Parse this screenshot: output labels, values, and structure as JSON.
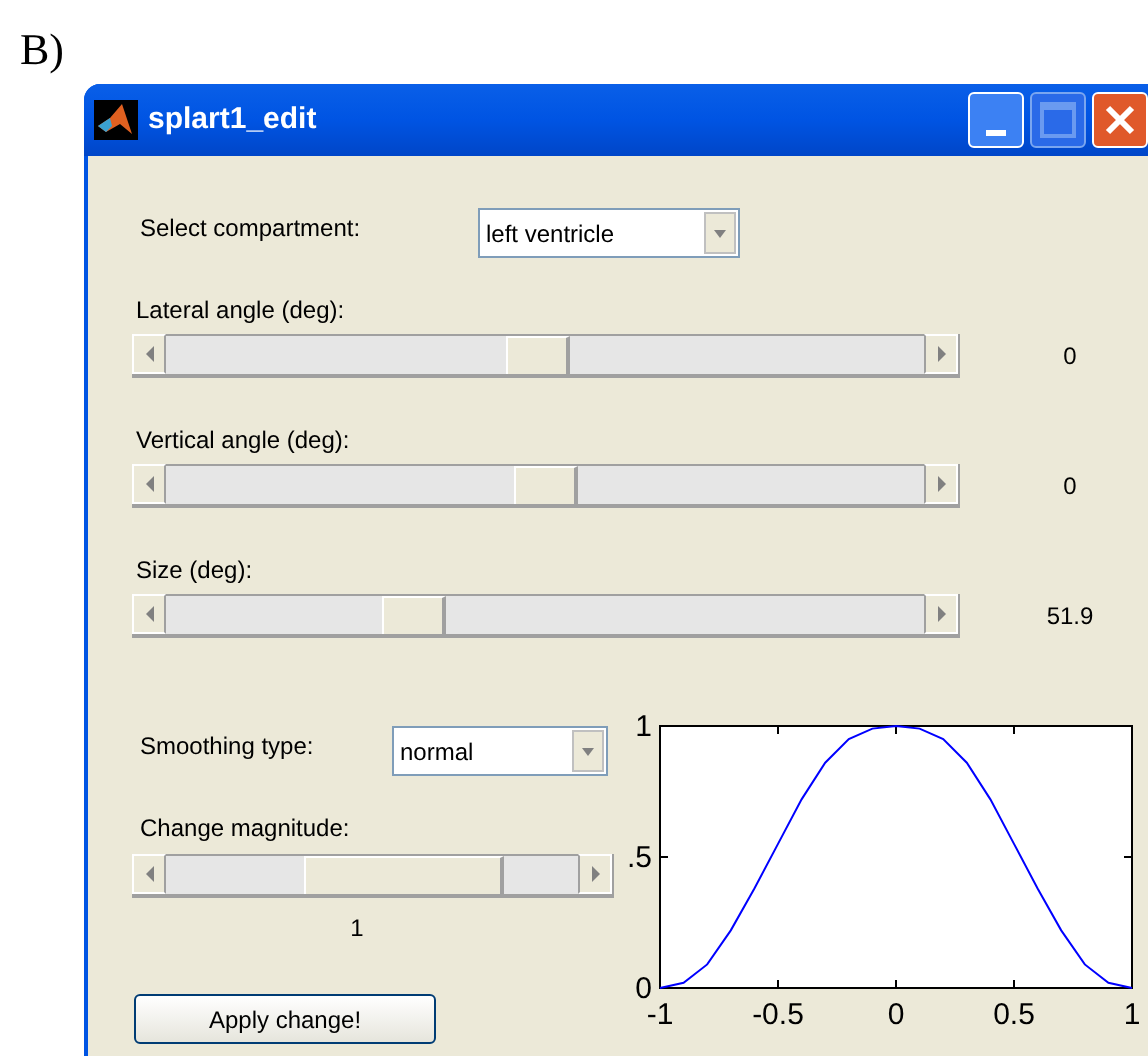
{
  "figure_label": "B)",
  "window": {
    "title": "splart1_edit"
  },
  "compartment": {
    "label": "Select compartment:",
    "value": "left ventricle"
  },
  "sliders": [
    {
      "label": "Lateral angle (deg):",
      "level": 0.49,
      "reading": "0"
    },
    {
      "label": "Vertical angle (deg):",
      "level": 0.5,
      "reading": "0"
    },
    {
      "label": "Size (deg):",
      "level": 0.31,
      "reading": "51.9"
    }
  ],
  "smoothing": {
    "label": "Smoothing type:",
    "value": "normal"
  },
  "magnitude": {
    "label": "Change magnitude:",
    "level": 0.65,
    "reading": "1"
  },
  "apply_button": "Apply change!",
  "chart_data": {
    "type": "line",
    "xlim": [
      -1,
      1
    ],
    "ylim": [
      0,
      1
    ],
    "xticks": [
      -1,
      -0.5,
      0,
      0.5,
      1
    ],
    "yticks": [
      0,
      {
        "value": 0.5,
        "label": ".5"
      },
      1
    ],
    "x": [
      -1,
      -0.9,
      -0.8,
      -0.7,
      -0.6,
      -0.5,
      -0.4,
      -0.3,
      -0.2,
      -0.1,
      0,
      0.1,
      0.2,
      0.3,
      0.4,
      0.5,
      0.6,
      0.7,
      0.8,
      0.9,
      1
    ],
    "series": [
      {
        "color": "#0000ff",
        "values": [
          0,
          0.02,
          0.09,
          0.22,
          0.38,
          0.55,
          0.72,
          0.86,
          0.95,
          0.99,
          1,
          0.99,
          0.95,
          0.86,
          0.72,
          0.55,
          0.38,
          0.22,
          0.09,
          0.02,
          0
        ]
      }
    ]
  }
}
